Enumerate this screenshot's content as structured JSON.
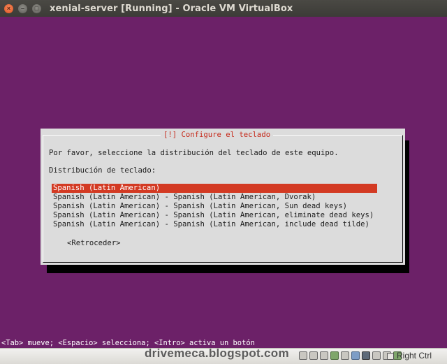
{
  "window": {
    "title": "xenial-server [Running] - Oracle VM VirtualBox",
    "close_glyph": "×",
    "minimize_glyph": "–",
    "maximize_glyph": "□"
  },
  "dialog": {
    "title": "[!] Configure el teclado",
    "prompt": "Por favor, seleccione la distribución del teclado de este equipo.",
    "list_label": "Distribución de teclado:",
    "options": [
      "Spanish (Latin American)",
      "Spanish (Latin American) - Spanish (Latin American, Dvorak)",
      "Spanish (Latin American) - Spanish (Latin American, Sun dead keys)",
      "Spanish (Latin American) - Spanish (Latin American, eliminate dead keys)",
      "Spanish (Latin American) - Spanish (Latin American, include dead tilde)"
    ],
    "selected_index": 0,
    "back_button": "<Retroceder>"
  },
  "help_line": "<Tab> mueve; <Espacio> selecciona; <Intro> activa un botón",
  "statusbar": {
    "watermark": "drivemeca.blogspot.com",
    "host_key": "Right Ctrl",
    "icons": [
      "hard-disk-icon",
      "optical-drive-icon",
      "audio-icon",
      "network-icon",
      "usb-icon",
      "shared-folder-icon",
      "display-icon",
      "video-capture-icon",
      "cpu-icon",
      "mouse-integration-icon",
      "keyboard-icon"
    ]
  },
  "colors": {
    "screen_bg": "#6c2168",
    "dialog_bg": "#dcdcdc",
    "highlight": "#d33a23",
    "title_red": "#c62b1c"
  }
}
